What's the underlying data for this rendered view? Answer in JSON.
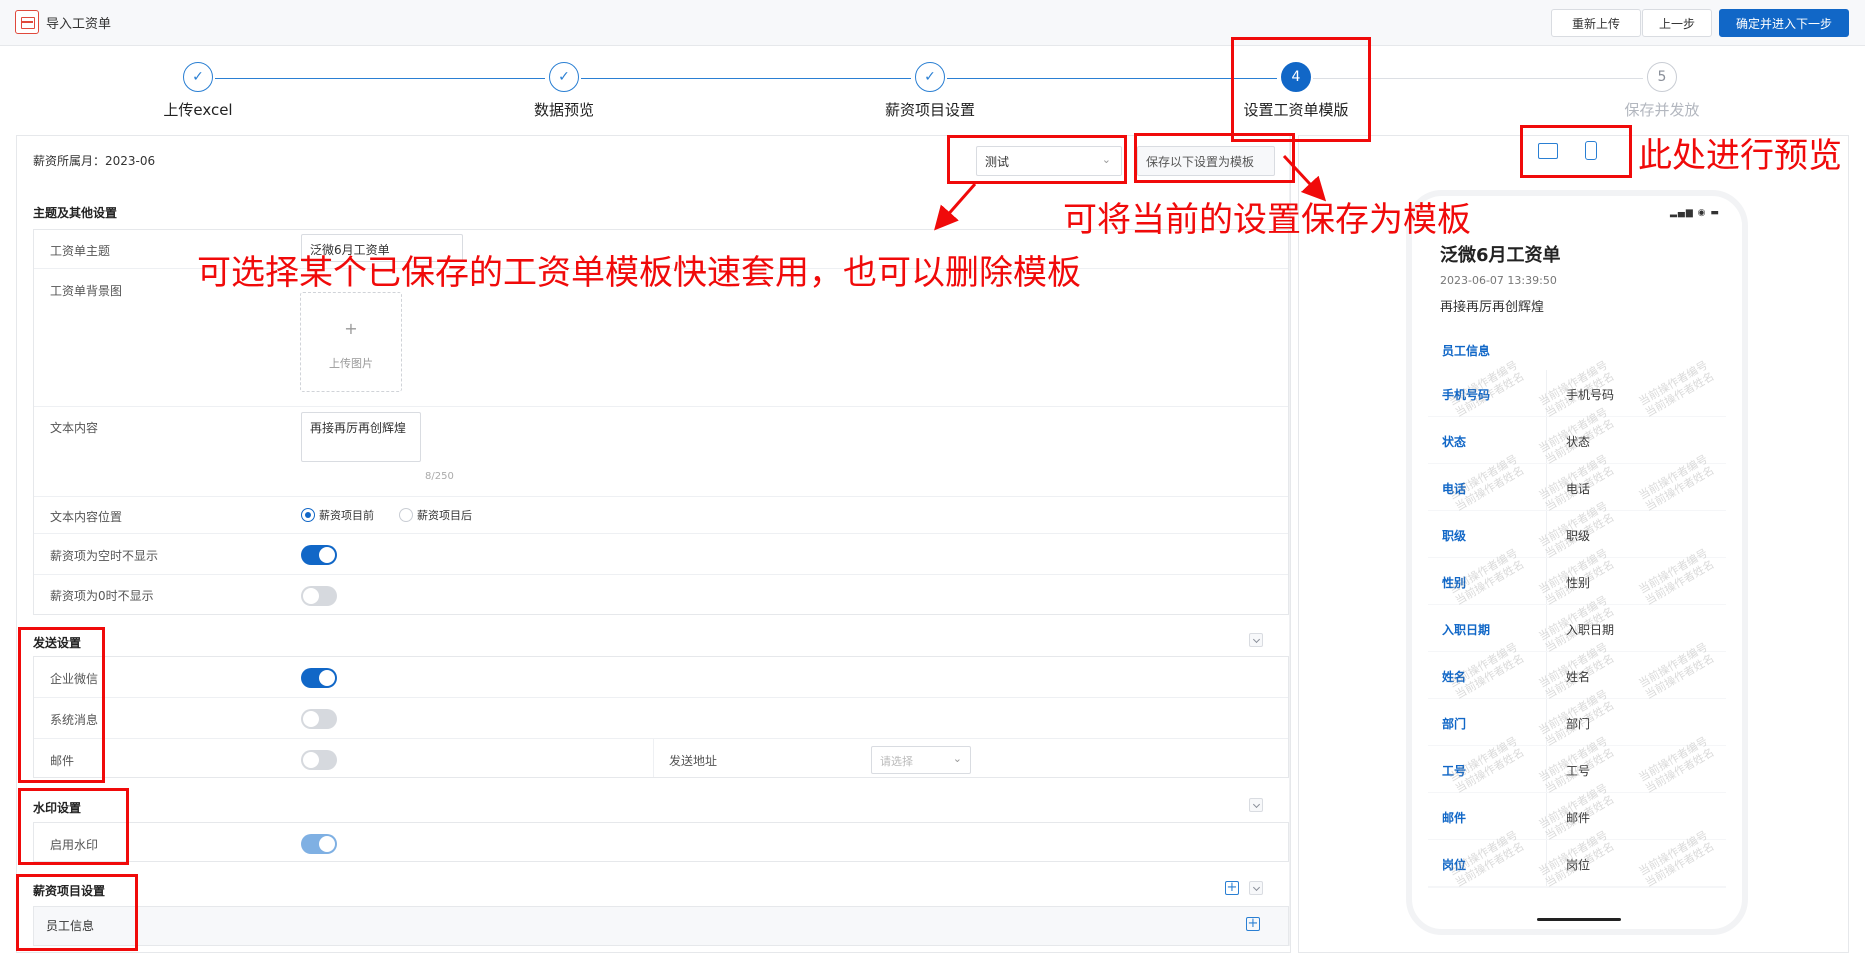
{
  "header": {
    "title": "导入工资单",
    "reupload_label": "重新上传",
    "prev_label": "上一步",
    "next_label": "确定并进入下一步"
  },
  "steps": [
    {
      "label": "上传excel",
      "status": "done"
    },
    {
      "label": "数据预览",
      "status": "done"
    },
    {
      "label": "薪资项目设置",
      "status": "done"
    },
    {
      "label": "设置工资单模版",
      "number": "4",
      "status": "active"
    },
    {
      "label": "保存并发放",
      "number": "5",
      "status": "todo"
    }
  ],
  "step_check": "✓",
  "main": {
    "month_label": "薪资所属月：2023-06",
    "template_select": "测试",
    "save_template_label": "保存以下设置为模板",
    "theme_section": {
      "title": "主题及其他设置",
      "subject_label": "工资单主题",
      "subject_value": "泛微6月工资单",
      "bg_label": "工资单背景图",
      "upload_plus": "+",
      "upload_label": "上传图片",
      "text_label": "文本内容",
      "text_value": "再接再厉再创辉煌",
      "text_count": "8/250",
      "position_label": "文本内容位置",
      "position_before": "薪资项目前",
      "position_after": "薪资项目后",
      "hide_empty_label": "薪资项为空时不显示",
      "hide_zero_label": "薪资项为0时不显示"
    },
    "send_section": {
      "title": "发送设置",
      "wechat_label": "企业微信",
      "system_label": "系统消息",
      "email_label": "邮件",
      "address_label": "发送地址",
      "address_placeholder": "请选择"
    },
    "watermark_section": {
      "title": "水印设置",
      "enable_label": "启用水印"
    },
    "salary_section": {
      "title": "薪资项目设置",
      "group_label": "员工信息"
    }
  },
  "annotations": {
    "template_hint": "可选择某个已保存的工资单模板快速套用，也可以删除模板",
    "save_hint": "可将当前的设置保存为模板",
    "preview_hint": "此处进行预览"
  },
  "preview": {
    "title": "泛微6月工资单",
    "datetime": "2023-06-07 13:39:50",
    "text": "再接再厉再创辉煌",
    "group": "员工信息",
    "fields": [
      {
        "key": "手机号码",
        "value": "手机号码"
      },
      {
        "key": "状态",
        "value": "状态"
      },
      {
        "key": "电话",
        "value": "电话"
      },
      {
        "key": "职级",
        "value": "职级"
      },
      {
        "key": "性别",
        "value": "性别"
      },
      {
        "key": "入职日期",
        "value": "入职日期"
      },
      {
        "key": "姓名",
        "value": "姓名"
      },
      {
        "key": "部门",
        "value": "部门"
      },
      {
        "key": "工号",
        "value": "工号"
      },
      {
        "key": "邮件",
        "value": "邮件"
      },
      {
        "key": "岗位",
        "value": "岗位"
      }
    ],
    "watermark_line1": "当前操作者编号",
    "watermark_line2": "当前操作者姓名"
  },
  "colors": {
    "primary": "#1167c7",
    "annotation": "#f00a0a"
  }
}
